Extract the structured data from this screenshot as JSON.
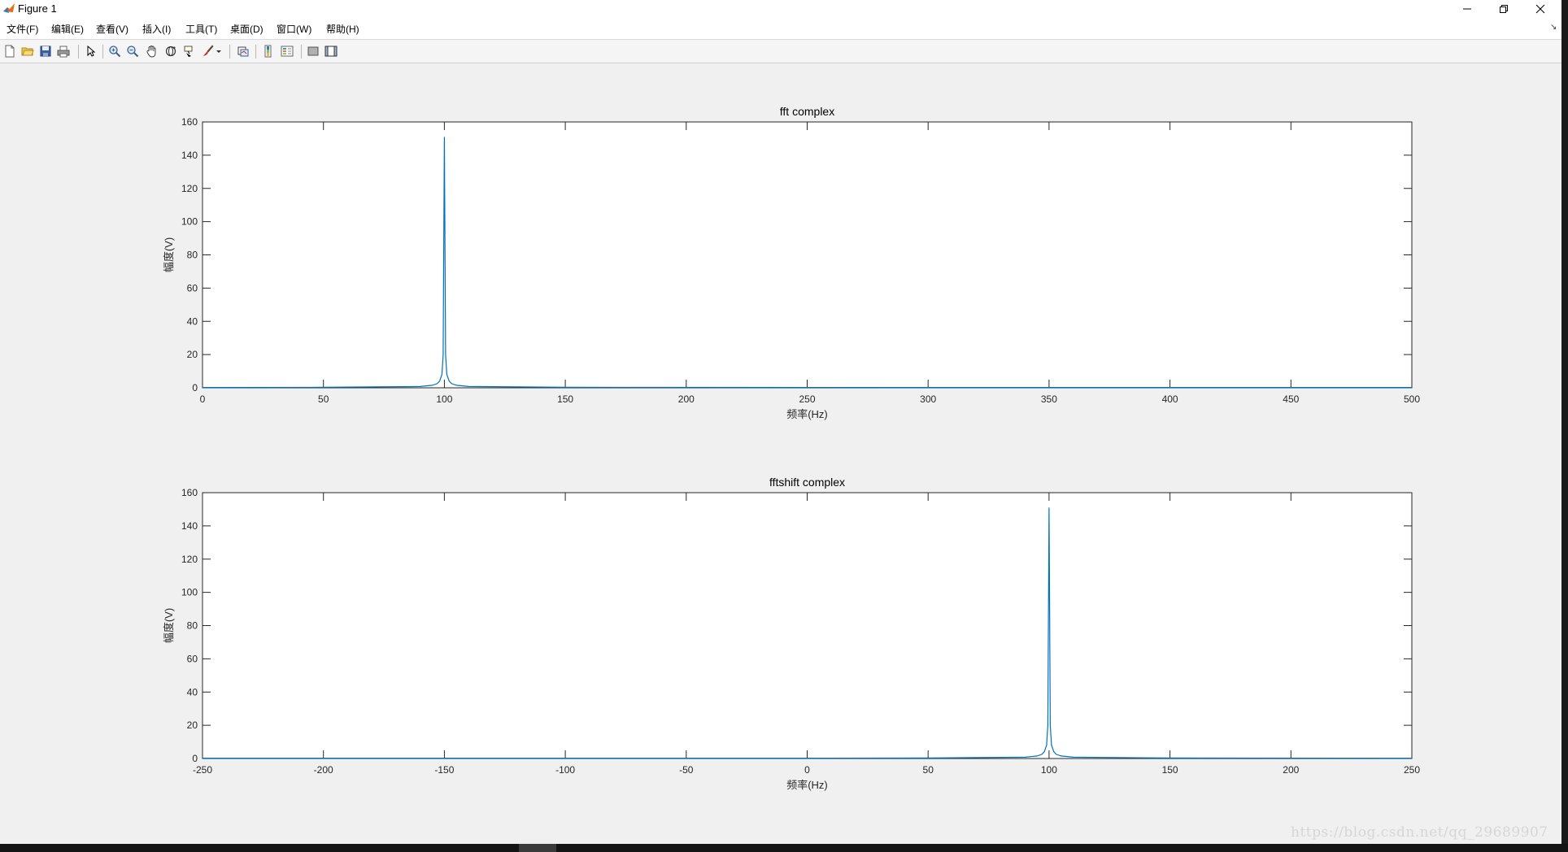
{
  "window": {
    "title": "Figure 1",
    "minimize_icon": "minimize-icon",
    "restore_icon": "restore-icon",
    "close_icon": "close-icon"
  },
  "menu": {
    "items": [
      "文件(F)",
      "编辑(E)",
      "查看(V)",
      "插入(I)",
      "工具(T)",
      "桌面(D)",
      "窗口(W)",
      "帮助(H)"
    ]
  },
  "toolbar": {
    "icons": [
      "new-figure-icon",
      "open-file-icon",
      "save-icon",
      "print-icon",
      "select-arrow-icon",
      "zoom-in-icon",
      "zoom-out-icon",
      "pan-hand-icon",
      "rotate-3d-icon",
      "data-cursor-icon",
      "brush-icon",
      "brush-dropdown-icon",
      "link-plot-icon",
      "insert-colorbar-icon",
      "insert-legend-icon",
      "hide-plot-tools-icon",
      "show-plot-tools-icon"
    ]
  },
  "watermark": "https://blog.csdn.net/qq_29689907",
  "colors": {
    "line": "#0072bd",
    "axes_bg": "#ffffff",
    "figure_bg": "#f0f0f0"
  },
  "chart_data": [
    {
      "type": "line",
      "title": "fft complex",
      "xlabel": "频率(Hz)",
      "ylabel": "幅度(V)",
      "xlim": [
        0,
        500
      ],
      "ylim": [
        0,
        160
      ],
      "xticks": [
        0,
        50,
        100,
        150,
        200,
        250,
        300,
        350,
        400,
        450,
        500
      ],
      "yticks": [
        0,
        20,
        40,
        60,
        80,
        100,
        120,
        140,
        160
      ],
      "grid": false,
      "series": [
        {
          "x": [
            0,
            50,
            90,
            95,
            97,
            98,
            99,
            99.5,
            100,
            100.5,
            101,
            102,
            103,
            105,
            110,
            150,
            300,
            500
          ],
          "y": [
            0.2,
            0.3,
            0.8,
            1.5,
            2.5,
            4,
            8,
            20,
            151,
            20,
            8,
            4,
            2.5,
            1.5,
            0.8,
            0.3,
            0.2,
            0.2
          ]
        }
      ]
    },
    {
      "type": "line",
      "title": "fftshift complex",
      "xlabel": "频率(Hz)",
      "ylabel": "幅度(V)",
      "xlim": [
        -250,
        250
      ],
      "ylim": [
        0,
        160
      ],
      "xticks": [
        -250,
        -200,
        -150,
        -100,
        -50,
        0,
        50,
        100,
        150,
        200,
        250
      ],
      "yticks": [
        0,
        20,
        40,
        60,
        80,
        100,
        120,
        140,
        160
      ],
      "grid": false,
      "series": [
        {
          "x": [
            -250,
            -100,
            0,
            50,
            90,
            95,
            97,
            98,
            99,
            99.5,
            100,
            100.5,
            101,
            102,
            103,
            105,
            110,
            150,
            250
          ],
          "y": [
            0.2,
            0.2,
            0.2,
            0.3,
            0.8,
            1.5,
            2.5,
            4,
            8,
            20,
            151,
            20,
            8,
            4,
            2.5,
            1.5,
            0.8,
            0.3,
            0.2
          ]
        }
      ]
    }
  ]
}
